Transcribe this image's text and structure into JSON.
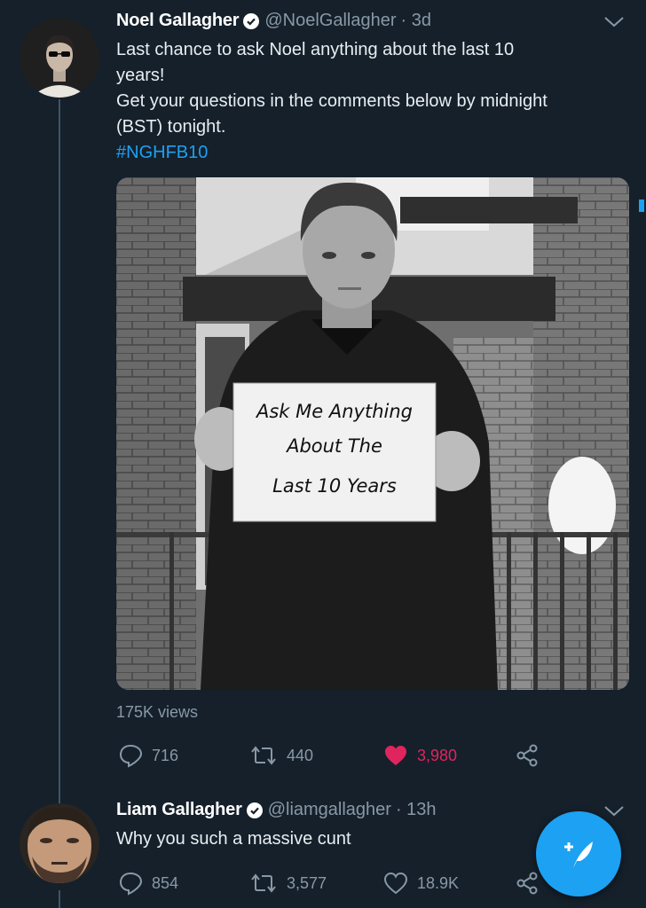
{
  "tweets": [
    {
      "name": "Noel Gallagher",
      "handle": "@NoelGallagher",
      "time": "· 3d",
      "text_line1": "Last chance to ask Noel anything about the last 10",
      "text_line2": "years!",
      "text_line3": "Get your questions in the comments below by midnight",
      "text_line4": "(BST) tonight.",
      "hashtag": "#NGHFB10",
      "sign_lines": [
        "Ask Me Anything",
        "About The",
        "Last 10 Years"
      ],
      "views": "175K views",
      "replies": "716",
      "retweets": "440",
      "likes": "3,980",
      "liked": true
    },
    {
      "name": "Liam Gallagher",
      "handle": "@liamgallagher",
      "time": "· 13h",
      "text": "Why you such a massive cunt",
      "replies": "854",
      "retweets": "3,577",
      "likes": "18.9K",
      "liked": false
    }
  ],
  "icons": {
    "verified": "verified-badge-icon",
    "more": "chevron-down-icon",
    "reply": "reply-icon",
    "retweet": "retweet-icon",
    "like": "heart-icon",
    "share": "share-icon",
    "compose": "compose-tweet-icon"
  },
  "colors": {
    "background": "#15202b",
    "accent": "#1da1f2",
    "like": "#e0245e",
    "secondary_text": "#8899a6"
  }
}
